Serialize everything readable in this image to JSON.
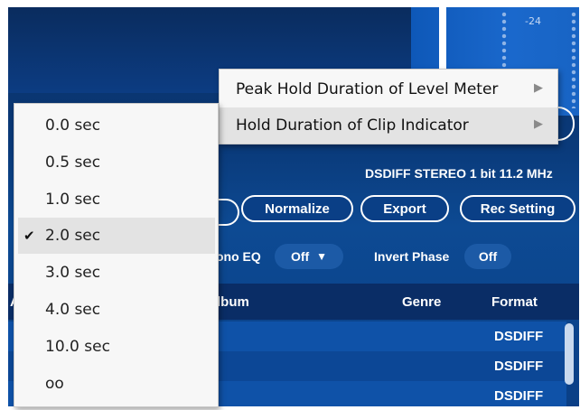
{
  "meter": {
    "scale_label": "-24"
  },
  "toolbar": {
    "normalize_label": "Normalize",
    "export_label": "Export",
    "rec_setting_label": "Rec Setting"
  },
  "format_info": "DSDIFF STEREO 1 bit 11.2 MHz",
  "eq": {
    "label": "ono EQ",
    "value": "Off",
    "arrow": "▼"
  },
  "invert_phase": {
    "label": "Invert Phase",
    "value": "Off"
  },
  "table": {
    "columns": {
      "album": "lbum",
      "genre": "Genre",
      "format": "Format",
      "left_partial": "A"
    },
    "rows": [
      {
        "format": "DSDIFF"
      },
      {
        "format": "DSDIFF"
      },
      {
        "format": "DSDIFF"
      }
    ]
  },
  "context_menu": {
    "items": [
      {
        "label": "Peak Hold Duration of Level Meter",
        "arrow": "▶"
      },
      {
        "label": "Hold Duration of Clip Indicator",
        "arrow": "▶"
      }
    ]
  },
  "submenu": {
    "check_mark": "✔",
    "items": [
      {
        "label": "0.0 sec",
        "checked": false
      },
      {
        "label": "0.5 sec",
        "checked": false
      },
      {
        "label": "1.0 sec",
        "checked": false
      },
      {
        "label": "2.0 sec",
        "checked": true
      },
      {
        "label": "3.0 sec",
        "checked": false
      },
      {
        "label": "4.0 sec",
        "checked": false
      },
      {
        "label": "10.0 sec",
        "checked": false
      },
      {
        "label": "oo",
        "checked": false
      }
    ]
  },
  "colors": {
    "app_bg": "#0a3f86",
    "menu_bg": "#f7f7f7",
    "highlight": "#e3e3e3"
  }
}
